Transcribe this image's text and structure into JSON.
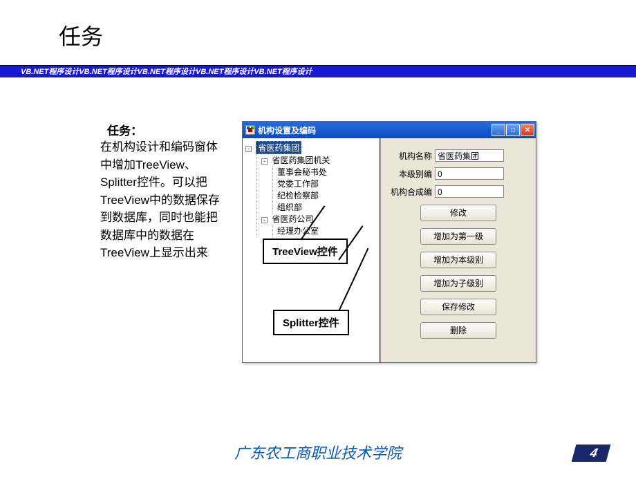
{
  "slide": {
    "title": "任务",
    "banner": "VB.NET程序设计VB.NET程序设计VB.NET程序设计VB.NET程序设计VB.NET程序设计",
    "task_label": "任务：",
    "task_body": "在机构设计和编码窗体中增加TreeView、Splitter控件。可以把TreeView中的数据保存到数据库，同时也能把数据库中的数据在TreeView上显示出来",
    "footer": "广东农工商职业技术学院",
    "page_number": "4"
  },
  "window": {
    "title": "机构设置及编码",
    "tree": {
      "root": "省医药集团",
      "node1": "省医药集团机关",
      "leaf1": "董事会秘书处",
      "leaf2": "党委工作部",
      "leaf3": "纪检检察部",
      "leaf4": "组织部",
      "node2": "省医药公司",
      "leaf5": "经理办公室"
    },
    "form": {
      "label_name": "机构名称",
      "value_name": "省医药集团",
      "label_level": "本级别编",
      "value_level": "0",
      "label_combined": "机构合成编",
      "value_combined": "0"
    },
    "buttons": {
      "modify": "修改",
      "add_first": "增加为第一级",
      "add_same": "增加为本级别",
      "add_child": "增加为子级别",
      "save": "保存修改",
      "delete": "删除"
    }
  },
  "callouts": {
    "treeview": "TreeView控件",
    "splitter": "Splitter控件"
  }
}
